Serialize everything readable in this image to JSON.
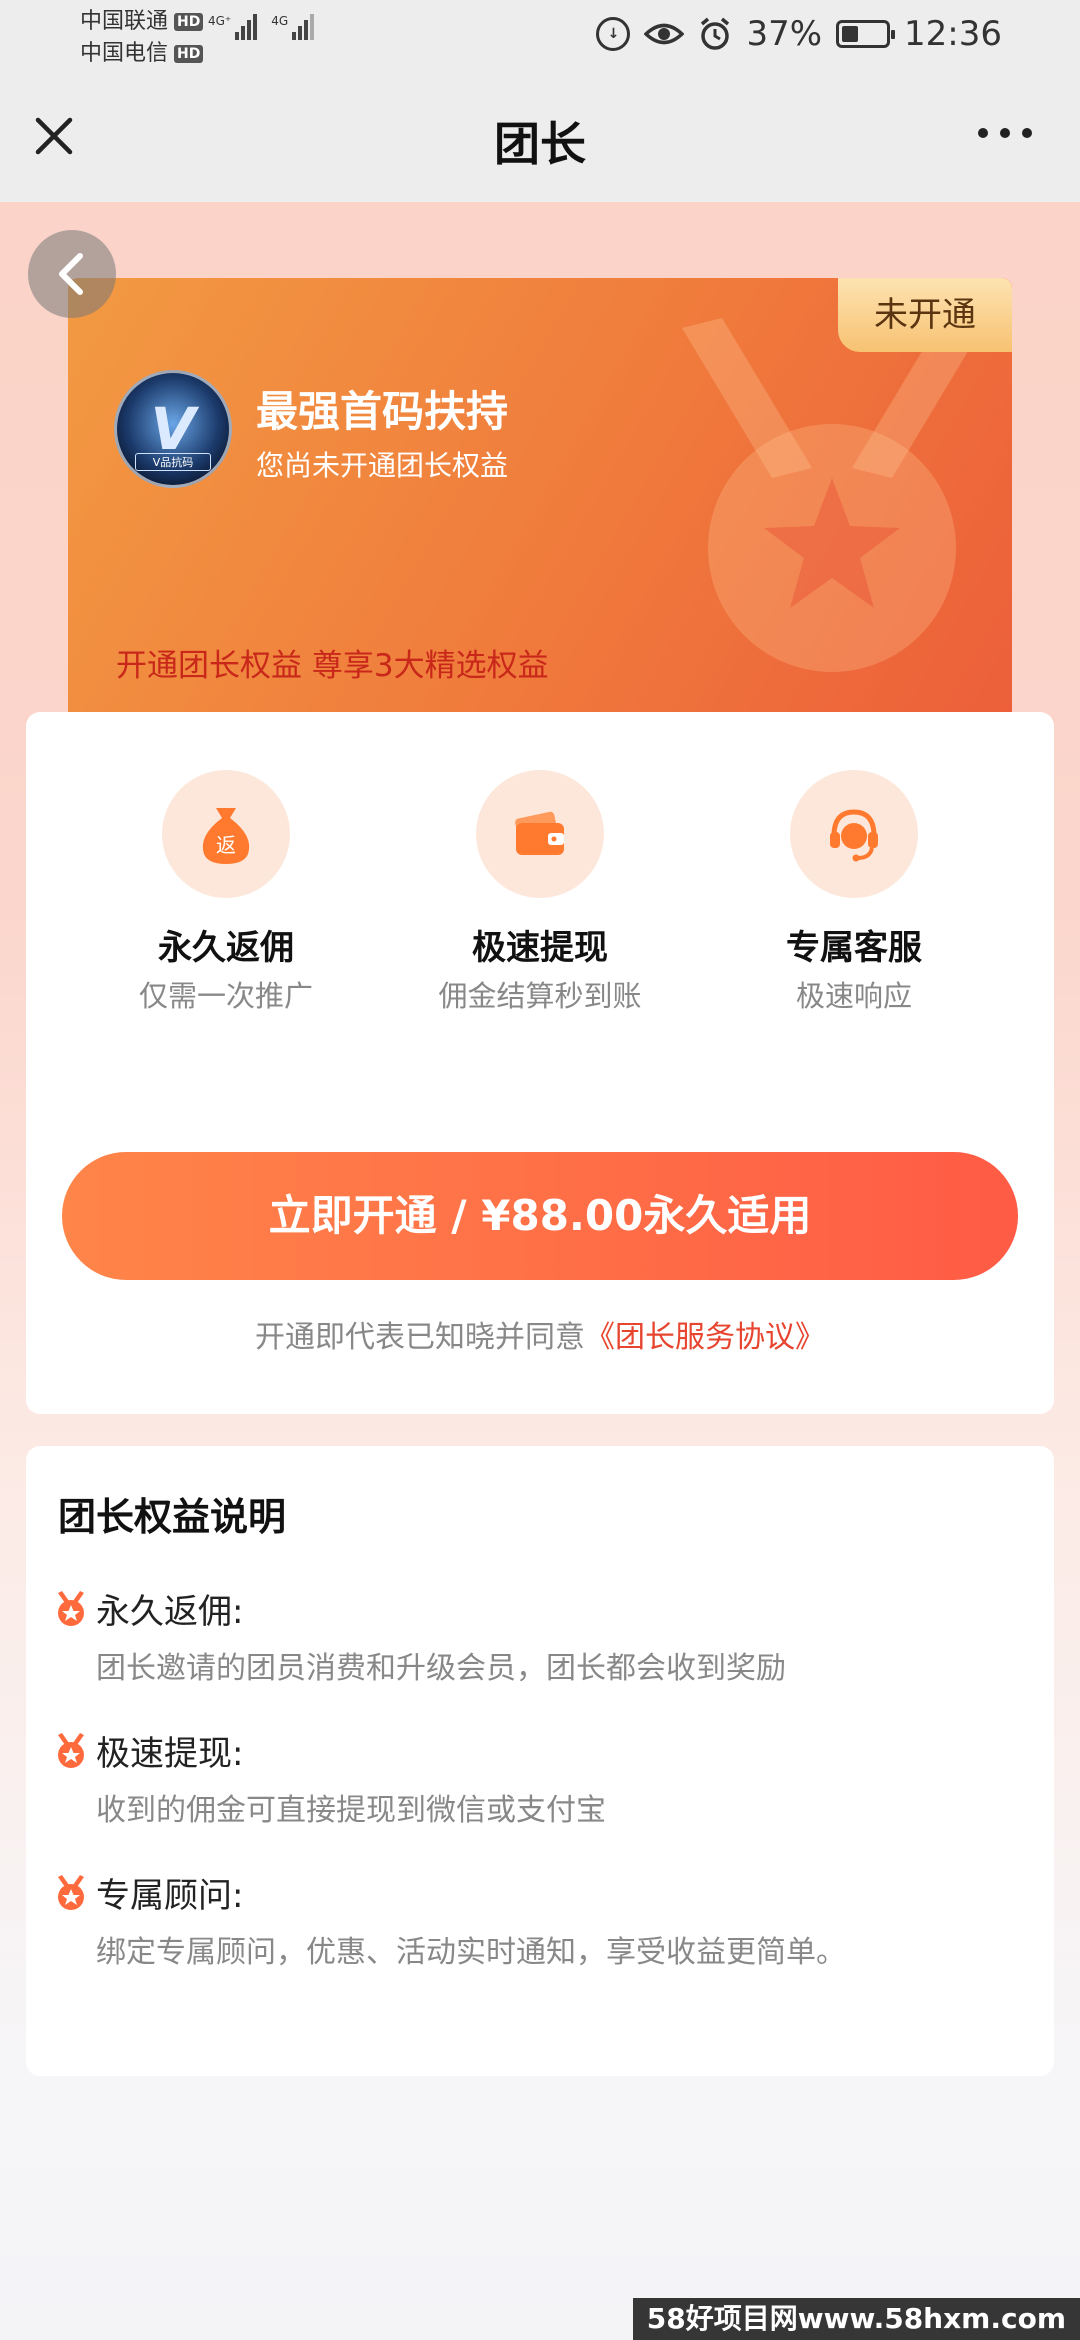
{
  "status_bar": {
    "carrier1": "中国联通",
    "carrier2": "中国电信",
    "hd": "HD",
    "net1": "4G⁺",
    "net2": "4G",
    "battery": "37%",
    "battery_level": 0.37,
    "time": "12:36"
  },
  "nav": {
    "title": "团长"
  },
  "hero": {
    "status_tag": "未开通",
    "avatar_caption": "V品抗码",
    "title": "最强首码扶持",
    "subtitle": "您尚未开通团长权益",
    "promo": "开通团长权益 尊享3大精选权益"
  },
  "benefits": [
    {
      "icon": "money-bag-icon",
      "badge": "返",
      "title": "永久返佣",
      "subtitle": "仅需一次推广"
    },
    {
      "icon": "wallet-icon",
      "title": "极速提现",
      "subtitle": "佣金结算秒到账"
    },
    {
      "icon": "customer-service-icon",
      "title": "专属客服",
      "subtitle": "极速响应"
    }
  ],
  "cta": {
    "label": "立即开通 / ¥88.00永久适用"
  },
  "agreement": {
    "prefix": "开通即代表已知晓并同意",
    "link": "《团长服务协议》"
  },
  "explanation": {
    "title": "团长权益说明",
    "items": [
      {
        "title": "永久返佣:",
        "desc": "团长邀请的团员消费和升级会员，团长都会收到奖励"
      },
      {
        "title": "极速提现:",
        "desc": "收到的佣金可直接提现到微信或支付宝"
      },
      {
        "title": "专属顾问:",
        "desc": "绑定专属顾问，优惠、活动实时通知，享受收益更简单。"
      }
    ]
  },
  "watermark": "58好项目网www.58hxm.com",
  "colors": {
    "accent": "#ff5b45",
    "hero_start": "#f29a42",
    "hero_end": "#ec5e3a",
    "link": "#e7452f"
  }
}
